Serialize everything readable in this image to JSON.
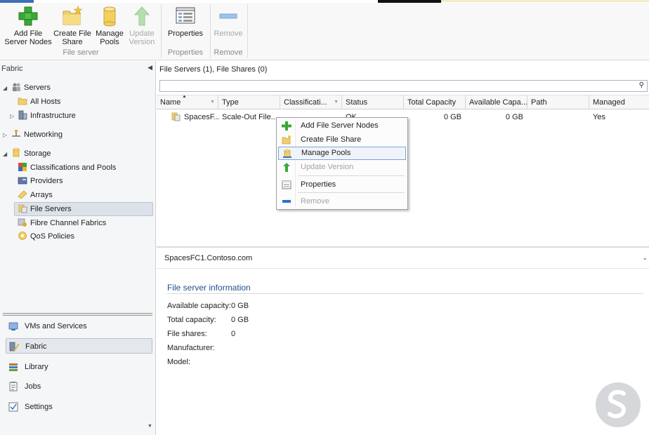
{
  "ribbon": {
    "groups": [
      {
        "label": "File server",
        "buttons": [
          {
            "label": "Add File Server Nodes",
            "line1": "Add File",
            "line2": "Server Nodes",
            "icon": "plus-icon",
            "enabled": true
          },
          {
            "label": "Create File Share",
            "line1": "Create File",
            "line2": "Share",
            "icon": "folder-star-icon",
            "enabled": true
          },
          {
            "label": "Manage Pools",
            "line1": "Manage",
            "line2": "Pools",
            "icon": "cylinder-icon",
            "enabled": true
          },
          {
            "label": "Update Version",
            "line1": "Update",
            "line2": "Version",
            "icon": "up-arrow-icon",
            "enabled": false
          }
        ]
      },
      {
        "label": "Properties",
        "buttons": [
          {
            "label": "Properties",
            "line1": "Properties",
            "line2": "",
            "icon": "properties-icon",
            "enabled": true
          }
        ]
      },
      {
        "label": "Remove",
        "buttons": [
          {
            "label": "Remove",
            "line1": "Remove",
            "line2": "",
            "icon": "remove-icon",
            "enabled": false
          }
        ]
      }
    ]
  },
  "left": {
    "header": "Fabric",
    "tree": {
      "servers": "Servers",
      "all_hosts": "All Hosts",
      "infrastructure": "Infrastructure",
      "networking": "Networking",
      "storage": "Storage",
      "classifications": "Classifications and Pools",
      "providers": "Providers",
      "arrays": "Arrays",
      "file_servers": "File Servers",
      "fibre_channel": "Fibre Channel Fabrics",
      "qos": "QoS Policies"
    },
    "workspaces": {
      "vms": "VMs and Services",
      "fabric": "Fabric",
      "library": "Library",
      "jobs": "Jobs",
      "settings": "Settings"
    }
  },
  "main": {
    "title": "File Servers (1), File Shares (0)",
    "search": {
      "value": ""
    },
    "columns": [
      "Name",
      "Type",
      "Classificati...",
      "Status",
      "Total Capacity",
      "Available Capa...",
      "Path",
      "Managed"
    ],
    "row": {
      "name": "SpacesF...",
      "type": "Scale-Out File...",
      "classification": "",
      "status": "OK",
      "total_capacity": "0 GB",
      "available_capacity": "0 GB",
      "path": "",
      "managed": "Yes"
    }
  },
  "details": {
    "title": "SpacesFC1.Contoso.com",
    "section": "File server information",
    "fields": [
      {
        "label": "Available capacity:",
        "value": "0 GB"
      },
      {
        "label": "Total capacity:",
        "value": "0 GB"
      },
      {
        "label": "File shares:",
        "value": "0"
      },
      {
        "label": "Manufacturer:",
        "value": ""
      },
      {
        "label": "Model:",
        "value": ""
      }
    ]
  },
  "context_menu": {
    "items": [
      {
        "label": "Add File Server Nodes",
        "enabled": true
      },
      {
        "label": "Create File Share",
        "enabled": true
      },
      {
        "label": "Manage Pools",
        "enabled": true
      },
      {
        "label": "Update Version",
        "enabled": false
      },
      {
        "label": "Properties",
        "enabled": true
      },
      {
        "label": "Remove",
        "enabled": false
      }
    ],
    "hovered": "Manage Pools"
  },
  "colors": {
    "accent": "#1f4e8c",
    "plus_green": "#3aa836",
    "disabled_text": "#a8a8a8"
  }
}
